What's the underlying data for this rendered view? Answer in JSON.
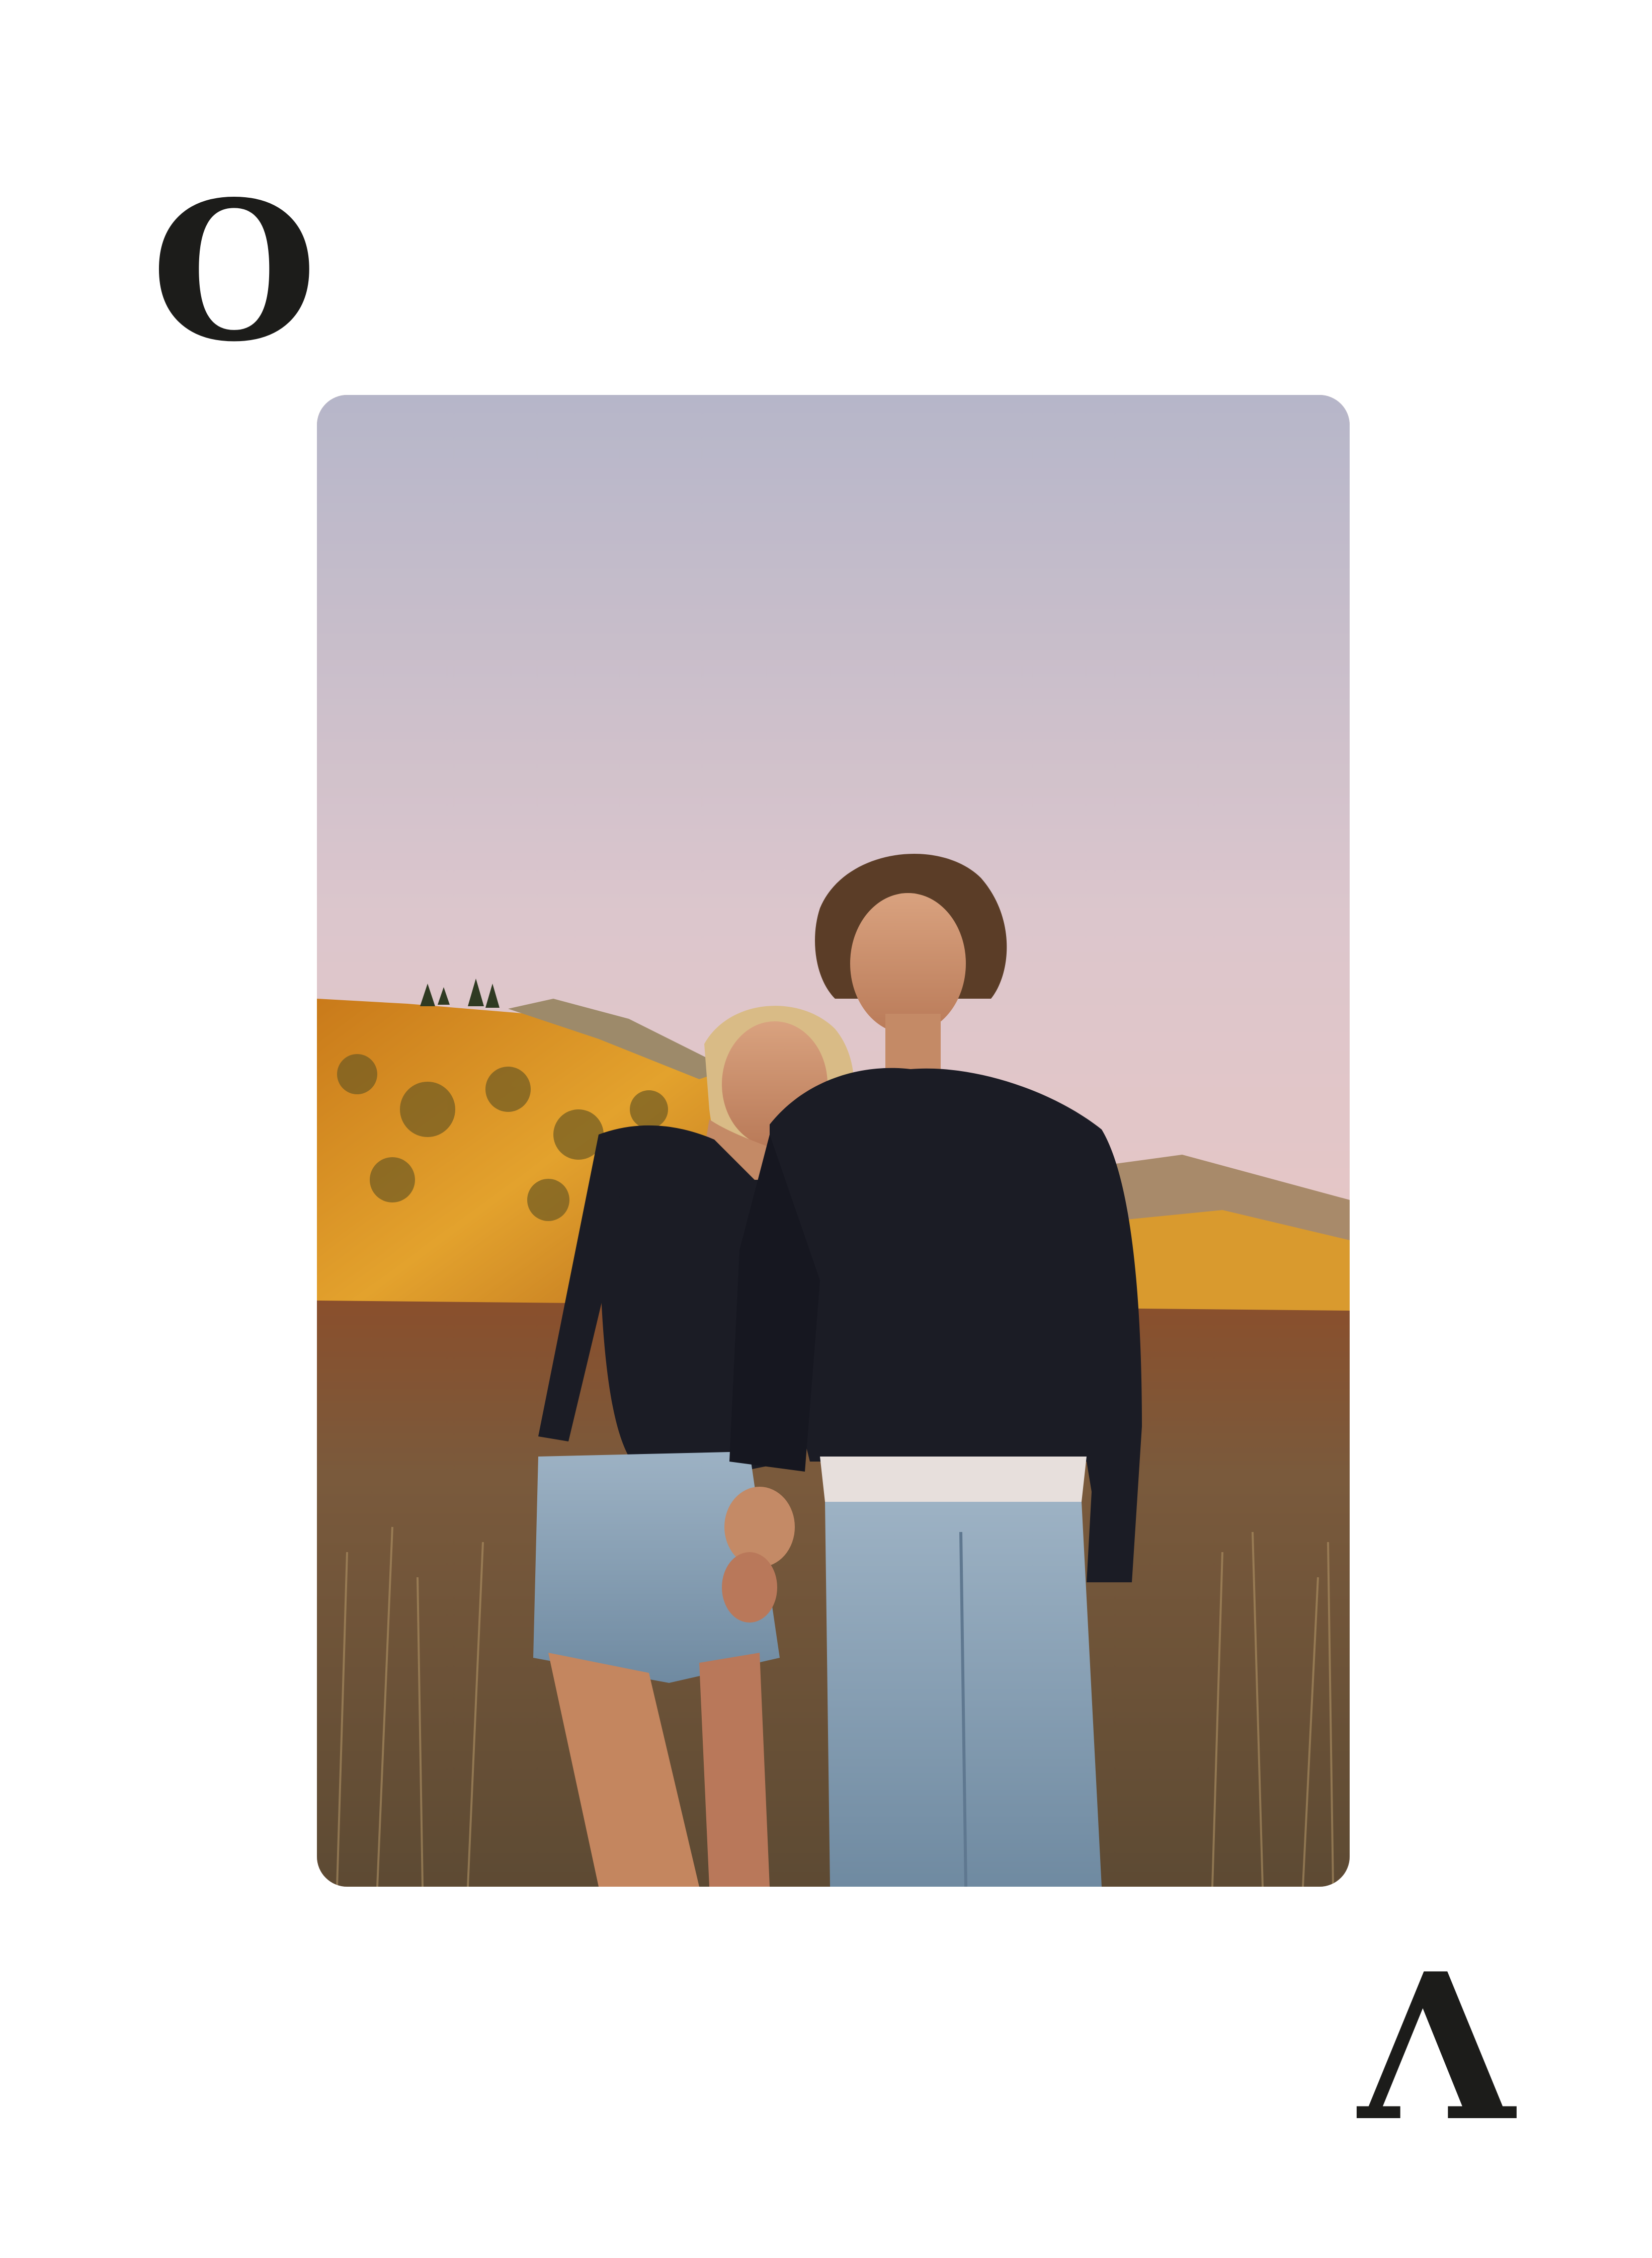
{
  "corner_letters": {
    "top_left": "O",
    "bottom_right": "Λ"
  },
  "photo": {
    "subject_icon": "couple-portrait-photo",
    "scene_colors": {
      "sky_top": "#b7b7c8",
      "sky_mid": "#e6c7c6",
      "sky_horizon": "#e3b3ad",
      "hill_foliage": "#d68a21",
      "field": "#7a5a3a",
      "sweater": "#1b1c25",
      "denim": "#8aa3b8"
    }
  }
}
